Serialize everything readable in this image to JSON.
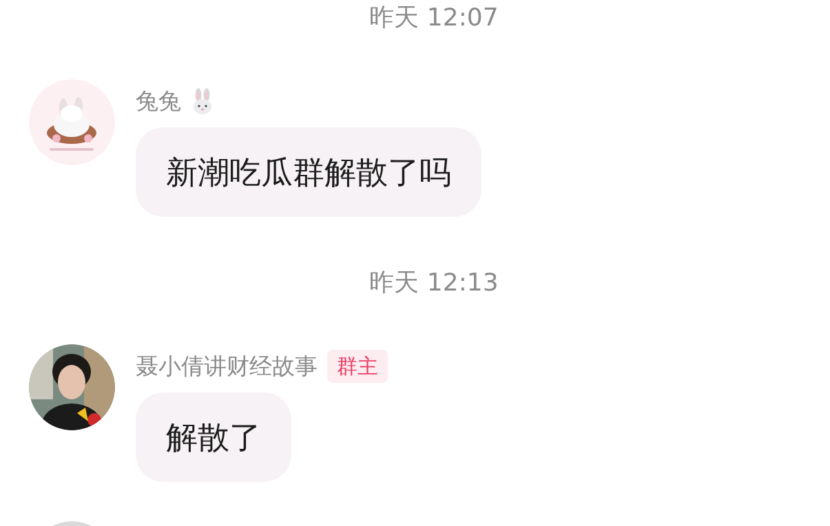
{
  "chat": [
    {
      "kind": "time",
      "text": "昨天 12:07"
    },
    {
      "kind": "message",
      "sender": "兔兔",
      "sender_icon": true,
      "text": "新潮吃瓜群解散了吗"
    },
    {
      "kind": "time",
      "text": "昨天 12:13"
    },
    {
      "kind": "message",
      "sender": "聂小倩讲财经故事",
      "badge": "群主",
      "text": "解散了"
    },
    {
      "kind": "avatar_only"
    }
  ]
}
